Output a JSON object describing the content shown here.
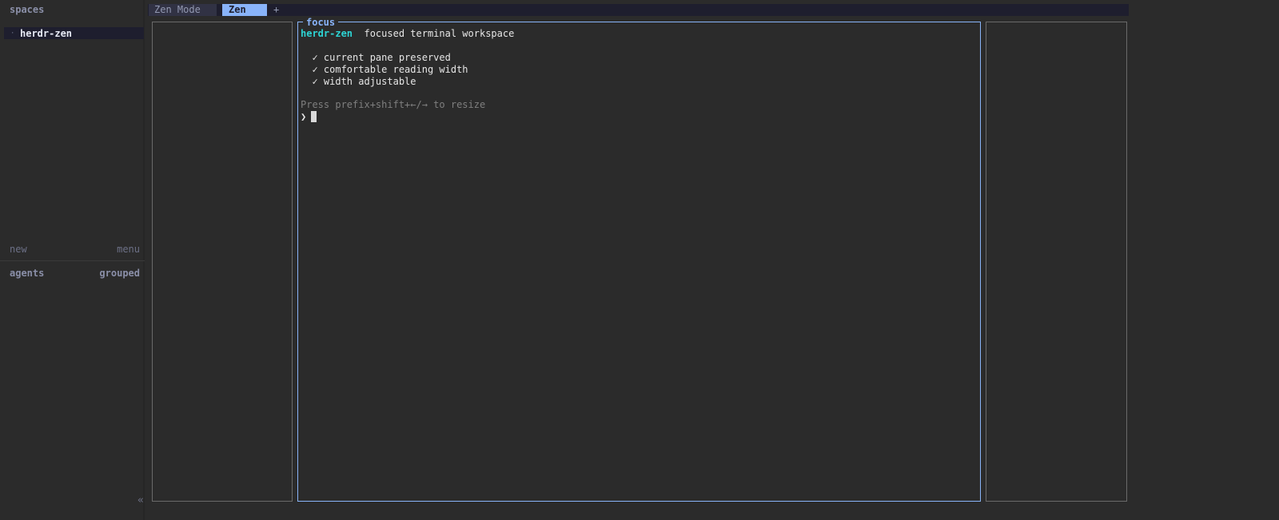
{
  "sidebar": {
    "spaces_title": "spaces",
    "spaces": [
      {
        "dot": "·",
        "label": "herdr-zen",
        "selected": true
      }
    ],
    "new_label": "new",
    "menu_label": "menu",
    "agents_title": "agents",
    "grouped_label": "grouped",
    "collapse_glyph": "«"
  },
  "tabs": {
    "items": [
      {
        "label": "Zen Mode",
        "active": false
      },
      {
        "label": "Zen",
        "active": true
      }
    ],
    "add_label": "+"
  },
  "focus_pane": {
    "title": "focus",
    "host": "herdr-zen",
    "description": "focused terminal workspace",
    "checklist": [
      "✓ current pane preserved",
      "✓ comfortable reading width",
      "✓ width adjustable"
    ],
    "hint": "Press prefix+shift+←/→ to resize",
    "prompt_symbol": "❯"
  },
  "colors": {
    "background": "#2b2b2b",
    "accent": "#89b4fa",
    "host": "#2dd4d4",
    "tabbar": "#1e1e2e"
  }
}
